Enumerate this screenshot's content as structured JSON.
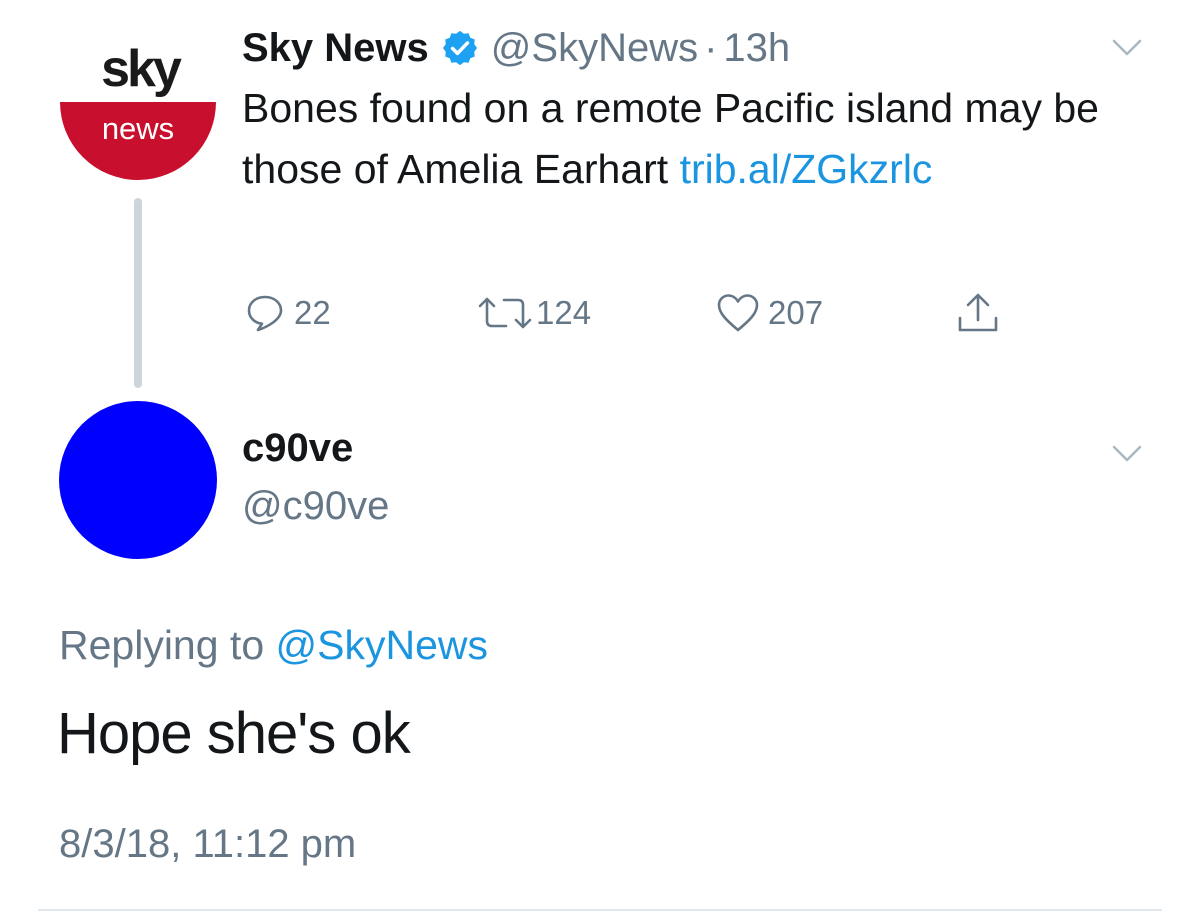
{
  "parent_tweet": {
    "avatar": {
      "logo_top": "sky",
      "logo_bottom": "news",
      "brand_color": "#c8102e"
    },
    "display_name": "Sky News",
    "verified_icon": "verified-badge-icon",
    "handle": "@SkyNews",
    "separator": "·",
    "time": "13h",
    "text": "Bones found on a remote Pacific island may be those of Amelia Earhart ",
    "link": "trib.al/ZGkzrlc",
    "actions": {
      "reply_count": "22",
      "retweet_count": "124",
      "like_count": "207"
    }
  },
  "reply": {
    "avatar_color": "#0000ff",
    "display_name": "c90ve",
    "handle": "@c90ve",
    "replying_prefix": "Replying to ",
    "replying_to": "@SkyNews",
    "text": "Hope she's ok",
    "timestamp": "8/3/18, 11:12 pm"
  },
  "colors": {
    "link": "#1b95e0",
    "secondary_text": "#657786",
    "thread_line": "#cdd5dc"
  }
}
